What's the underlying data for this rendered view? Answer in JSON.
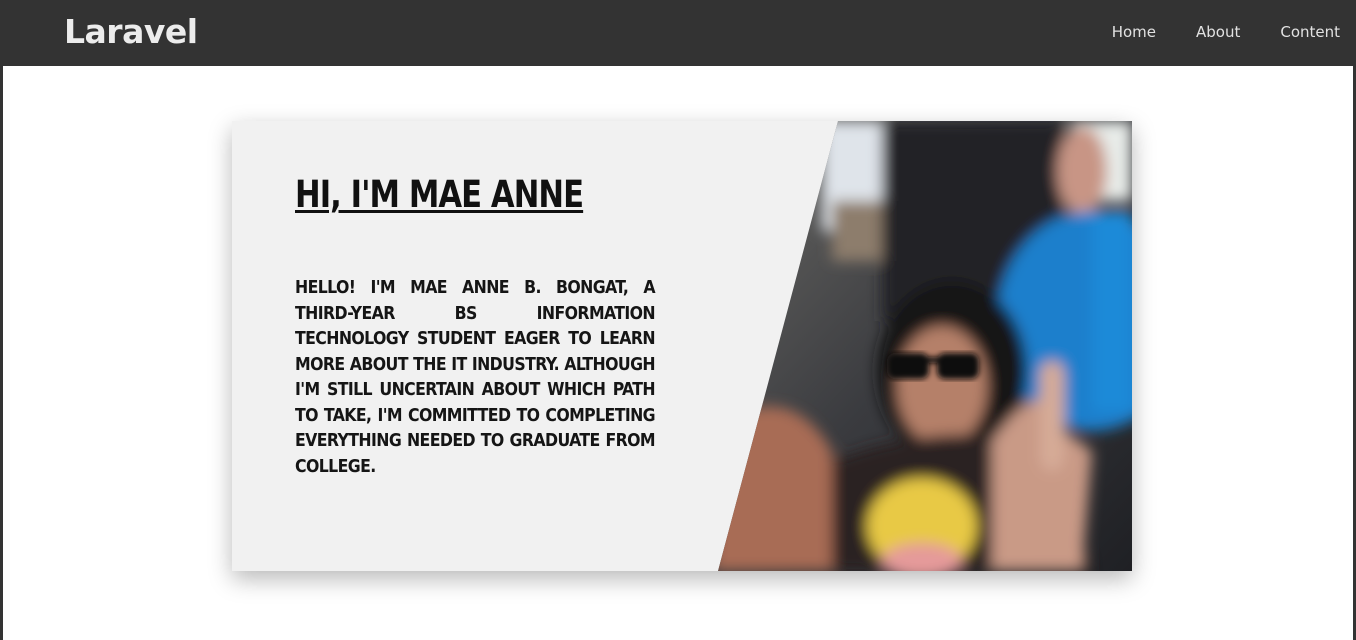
{
  "navbar": {
    "brand": "Laravel",
    "links": [
      "Home",
      "About",
      "Content"
    ],
    "background": "#333333"
  },
  "hero": {
    "title": "Hi, I'm Mae Anne",
    "body": "Hello! I'm Mae Anne B. Bongat, a third-year BS Information Technology student eager to learn more about the IT industry. Although I'm still uncertain about which path to take, I'm committed to completing everything needed to graduate from college.",
    "card_background": "#f1f1f1",
    "photo_icon": "profile-photo"
  }
}
